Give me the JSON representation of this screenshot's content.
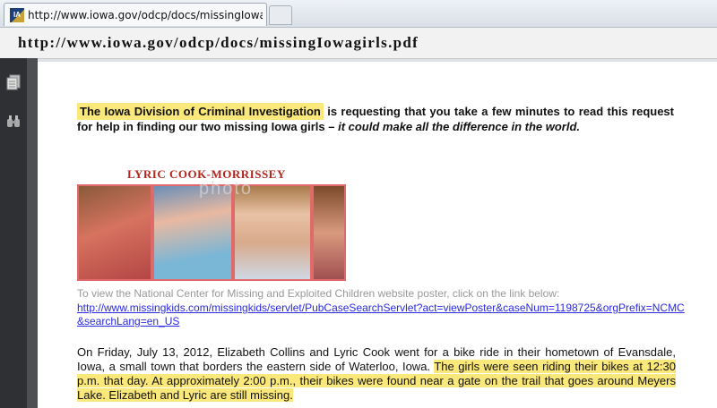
{
  "browser": {
    "tab_title": "http://www.iowa.gov/odcp/docs/missingIowagir...",
    "favicon_label": "IA"
  },
  "banner": {
    "url": "http://www.iowa.gov/odcp/docs/missingIowagirls.pdf"
  },
  "sidebar": {
    "icons": [
      "pages-icon",
      "binoculars-icon"
    ]
  },
  "document": {
    "intro_highlight": "The Iowa Division of Criminal Investigation",
    "intro_rest": " is requesting that you take a few minutes to read this request for help in finding our two missing Iowa girls – ",
    "intro_italic": "it could make all the difference in the world.",
    "poster_name": "LYRIC COOK-MORRISSEY",
    "watermark": "photo",
    "poster_note": "To view the National Center for Missing and Exploited Children website poster, click on the link below:",
    "poster_link": "http://www.missingkids.com/missingkids/servlet/PubCaseSearchServlet?act=viewPoster&caseNum=1198725&orgPrefix=NCMC&searchLang=en_US",
    "story_plain": "On Friday, July 13, 2012, Elizabeth Collins and Lyric Cook went for a bike ride in their hometown of Evansdale, Iowa, a small town that borders the eastern side of Waterloo, Iowa. ",
    "story_highlight": "The girls were seen riding their bikes at 12:30 p.m. that day.  At approximately 2:00 p.m., their bikes were found near a gate on the trail that goes around Meyers Lake.  Elizabeth and Lyric are still missing."
  }
}
